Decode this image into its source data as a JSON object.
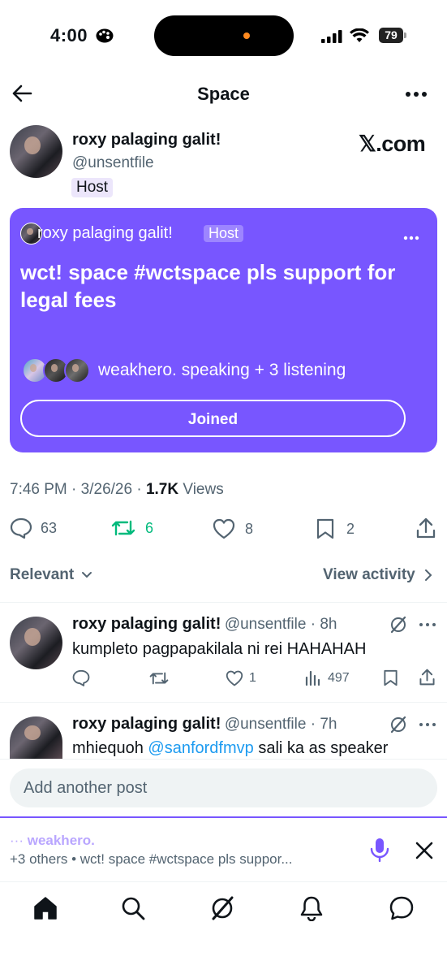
{
  "status_bar": {
    "time": "4:00",
    "battery": "79"
  },
  "header": {
    "title": "Space"
  },
  "host": {
    "name": "roxy palaging galit!",
    "handle": "@unsentfile",
    "badge": "Host",
    "brand": "𝕏.com"
  },
  "space_card": {
    "host_name": "roxy palaging galit!",
    "host_badge": "Host",
    "title": "wct! space #wctspace pls support for legal fees",
    "listeners": "weakhero. speaking + 3 listening",
    "joined_label": "Joined",
    "color": "#7856ff"
  },
  "post_meta": {
    "time": "7:46 PM",
    "date": "3/26/26",
    "views_count": "1.7K",
    "views_label": "Views"
  },
  "actions": {
    "replies": "63",
    "reposts": "6",
    "likes": "8",
    "bookmarks": "2"
  },
  "sort": {
    "relevant": "Relevant",
    "view_activity": "View activity"
  },
  "replies": [
    {
      "name": "roxy palaging galit!",
      "handle": "@unsentfile",
      "time": "8h",
      "text": "kumpleto pagpapakilala ni rei HAHAHAH",
      "likes": "1",
      "views": "497"
    },
    {
      "name": "roxy palaging galit!",
      "handle": "@unsentfile",
      "time": "7h",
      "text_before": "mhiequoh ",
      "mention": "@sanfordfmvp",
      "text_after": " sali ka as speaker"
    }
  ],
  "composer": {
    "placeholder": "Add another post"
  },
  "dock": {
    "speaker": "weakhero.",
    "subtitle": "+3 others • wct! space #wctspace pls suppor..."
  },
  "colors": {
    "repost_green": "#00ba7c",
    "link_blue": "#1d9bf0",
    "mic_purple": "#7856ff"
  }
}
